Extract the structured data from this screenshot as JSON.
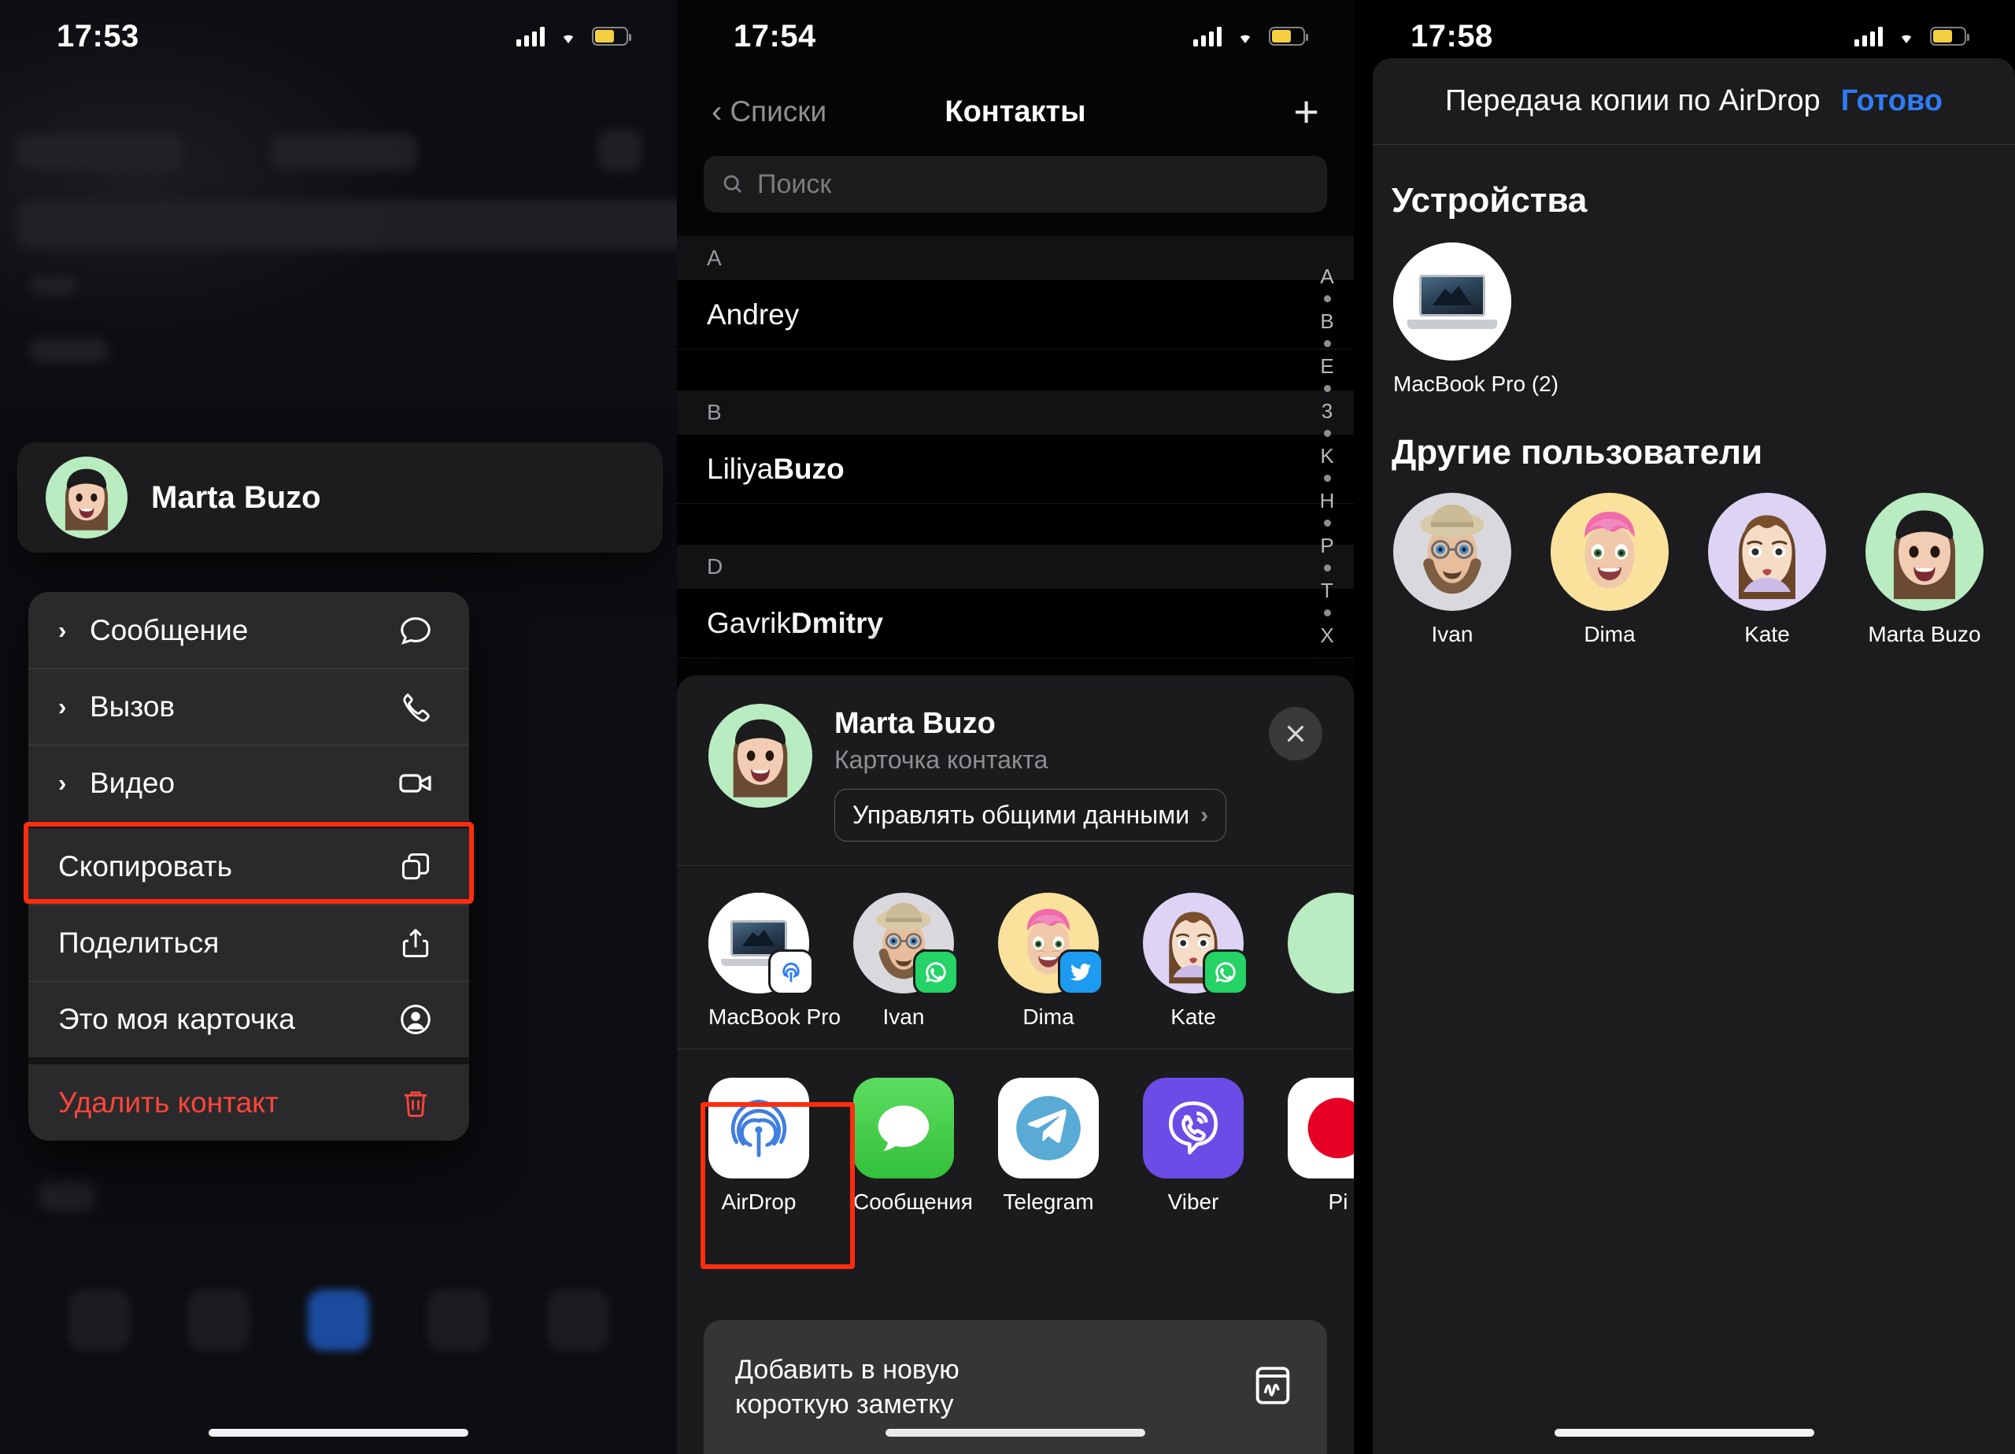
{
  "panel1": {
    "status": {
      "time": "17:53"
    },
    "contact_card": {
      "name": "Marta Buzo"
    },
    "context_menu": [
      {
        "label": "Сообщение",
        "icon": "message-bubble-icon",
        "chevron": true,
        "danger": false
      },
      {
        "label": "Вызов",
        "icon": "phone-icon",
        "chevron": true,
        "danger": false
      },
      {
        "label": "Видео",
        "icon": "video-camera-icon",
        "chevron": true,
        "danger": false
      },
      {
        "label": "Скопировать",
        "icon": "copy-icon",
        "chevron": false,
        "danger": false
      },
      {
        "label": "Поделиться",
        "icon": "share-icon",
        "chevron": false,
        "danger": false,
        "highlighted": true
      },
      {
        "label": "Это моя карточка",
        "icon": "person-circle-icon",
        "chevron": false,
        "danger": false
      },
      {
        "label": "Удалить контакт",
        "icon": "trash-icon",
        "chevron": false,
        "danger": true
      }
    ],
    "highlight_color": "#ff2d10"
  },
  "panel2": {
    "status": {
      "time": "17:54"
    },
    "nav": {
      "back_label": "Списки",
      "title": "Контакты",
      "add_label": "+"
    },
    "search": {
      "placeholder": "Поиск",
      "value": ""
    },
    "contacts": [
      {
        "section": "A",
        "items": [
          {
            "first": "Andrey",
            "last": ""
          }
        ]
      },
      {
        "section": "B",
        "items": [
          {
            "first": "Liliya ",
            "last": "Buzo"
          }
        ]
      },
      {
        "section": "D",
        "items": [
          {
            "first": "Gavrik ",
            "last": "Dmitry"
          }
        ]
      }
    ],
    "alpha_index": [
      "A",
      "•",
      "B",
      "•",
      "E",
      "•",
      "3",
      "•",
      "K",
      "•",
      "H",
      "•",
      "P",
      "•",
      "T",
      "•",
      "X"
    ],
    "share_sheet": {
      "title": "Marta Buzo",
      "subtitle": "Карточка контакта",
      "manage_label": "Управлять общими данными",
      "close_label": "✕",
      "people": [
        {
          "label": "MacBook Pro",
          "kind": "macbook",
          "badge": "airdrop",
          "bg": "#ffffff"
        },
        {
          "label": "Ivan",
          "kind": "memoji-ivan",
          "badge": "whatsapp",
          "bg": "#d9d9dd"
        },
        {
          "label": "Dima",
          "kind": "memoji-dima",
          "badge": "twitter",
          "bg": "#fae29c"
        },
        {
          "label": "Kate",
          "kind": "memoji-kate",
          "badge": "whatsapp",
          "bg": "#ddd3f5"
        },
        {
          "label": "",
          "kind": "memoji-marta",
          "badge": "none",
          "bg": "#b9ecc0"
        }
      ],
      "apps": [
        {
          "label": "AirDrop",
          "icon": "airdrop-icon",
          "bg": "#ffffff",
          "highlighted": true
        },
        {
          "label": "Сообщения",
          "icon": "messages-icon",
          "bg": "#5cd55f"
        },
        {
          "label": "Telegram",
          "icon": "telegram-icon",
          "bg": "#ffffff"
        },
        {
          "label": "Viber",
          "icon": "viber-icon",
          "bg": "#6c4ce6"
        },
        {
          "label": "Pi",
          "icon": "pinterest-icon",
          "bg": "#ffffff"
        }
      ],
      "note_action": {
        "line1": "Добавить в новую",
        "line2": "короткую заметку",
        "icon": "quick-note-icon"
      }
    },
    "highlight_color": "#ff2d10"
  },
  "panel3": {
    "status": {
      "time": "17:58"
    },
    "header": {
      "title": "Передача копии по AirDrop",
      "done_label": "Готово"
    },
    "devices_title": "Устройства",
    "devices": [
      {
        "label": "MacBook Pro (2)",
        "kind": "macbook",
        "bg": "#ffffff"
      }
    ],
    "others_title": "Другие пользователи",
    "others": [
      {
        "label": "Ivan",
        "kind": "memoji-ivan",
        "bg": "#d9d9dd"
      },
      {
        "label": "Dima",
        "kind": "memoji-dima",
        "bg": "#fae29c"
      },
      {
        "label": "Kate",
        "kind": "memoji-kate",
        "bg": "#ddd3f5"
      },
      {
        "label": "Marta Buzo",
        "kind": "memoji-marta",
        "bg": "#b9ecc0"
      }
    ],
    "accent_color": "#2f7cf6"
  }
}
